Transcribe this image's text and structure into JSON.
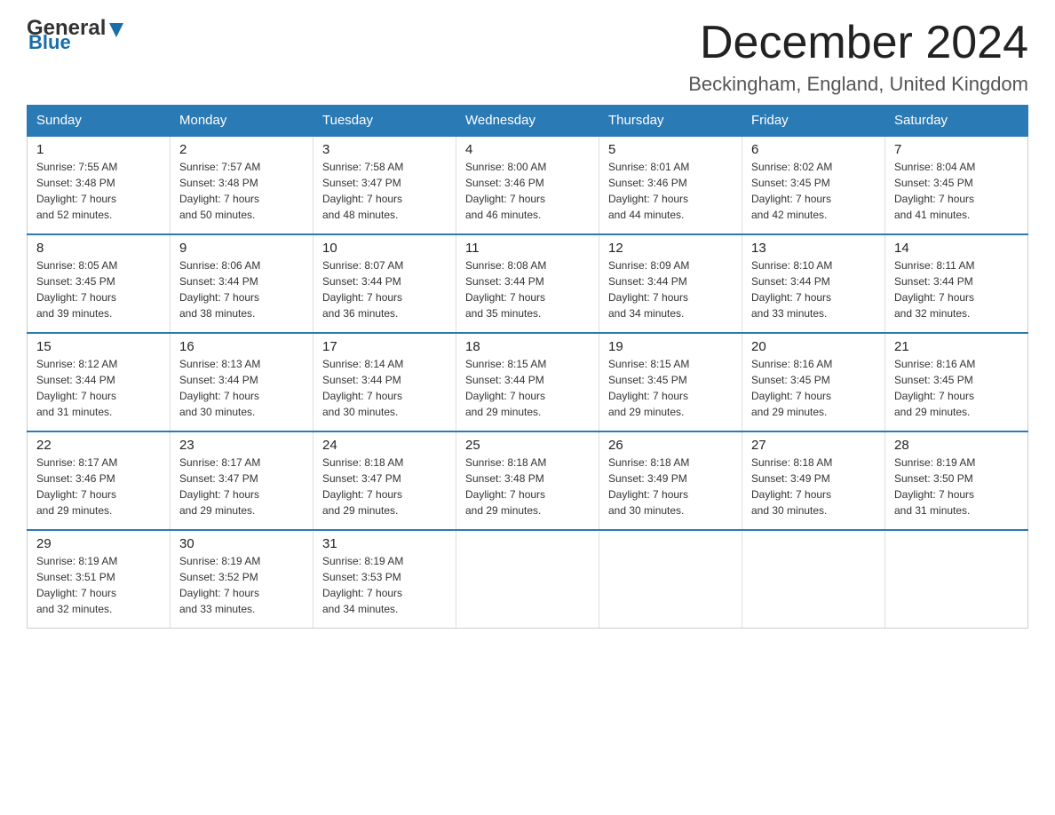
{
  "header": {
    "month_year": "December 2024",
    "location": "Beckingham, England, United Kingdom",
    "logo_text1": "General",
    "logo_text2": "Blue"
  },
  "days_of_week": [
    "Sunday",
    "Monday",
    "Tuesday",
    "Wednesday",
    "Thursday",
    "Friday",
    "Saturday"
  ],
  "weeks": [
    [
      {
        "day": "1",
        "sunrise": "7:55 AM",
        "sunset": "3:48 PM",
        "daylight": "7 hours and 52 minutes."
      },
      {
        "day": "2",
        "sunrise": "7:57 AM",
        "sunset": "3:48 PM",
        "daylight": "7 hours and 50 minutes."
      },
      {
        "day": "3",
        "sunrise": "7:58 AM",
        "sunset": "3:47 PM",
        "daylight": "7 hours and 48 minutes."
      },
      {
        "day": "4",
        "sunrise": "8:00 AM",
        "sunset": "3:46 PM",
        "daylight": "7 hours and 46 minutes."
      },
      {
        "day": "5",
        "sunrise": "8:01 AM",
        "sunset": "3:46 PM",
        "daylight": "7 hours and 44 minutes."
      },
      {
        "day": "6",
        "sunrise": "8:02 AM",
        "sunset": "3:45 PM",
        "daylight": "7 hours and 42 minutes."
      },
      {
        "day": "7",
        "sunrise": "8:04 AM",
        "sunset": "3:45 PM",
        "daylight": "7 hours and 41 minutes."
      }
    ],
    [
      {
        "day": "8",
        "sunrise": "8:05 AM",
        "sunset": "3:45 PM",
        "daylight": "7 hours and 39 minutes."
      },
      {
        "day": "9",
        "sunrise": "8:06 AM",
        "sunset": "3:44 PM",
        "daylight": "7 hours and 38 minutes."
      },
      {
        "day": "10",
        "sunrise": "8:07 AM",
        "sunset": "3:44 PM",
        "daylight": "7 hours and 36 minutes."
      },
      {
        "day": "11",
        "sunrise": "8:08 AM",
        "sunset": "3:44 PM",
        "daylight": "7 hours and 35 minutes."
      },
      {
        "day": "12",
        "sunrise": "8:09 AM",
        "sunset": "3:44 PM",
        "daylight": "7 hours and 34 minutes."
      },
      {
        "day": "13",
        "sunrise": "8:10 AM",
        "sunset": "3:44 PM",
        "daylight": "7 hours and 33 minutes."
      },
      {
        "day": "14",
        "sunrise": "8:11 AM",
        "sunset": "3:44 PM",
        "daylight": "7 hours and 32 minutes."
      }
    ],
    [
      {
        "day": "15",
        "sunrise": "8:12 AM",
        "sunset": "3:44 PM",
        "daylight": "7 hours and 31 minutes."
      },
      {
        "day": "16",
        "sunrise": "8:13 AM",
        "sunset": "3:44 PM",
        "daylight": "7 hours and 30 minutes."
      },
      {
        "day": "17",
        "sunrise": "8:14 AM",
        "sunset": "3:44 PM",
        "daylight": "7 hours and 30 minutes."
      },
      {
        "day": "18",
        "sunrise": "8:15 AM",
        "sunset": "3:44 PM",
        "daylight": "7 hours and 29 minutes."
      },
      {
        "day": "19",
        "sunrise": "8:15 AM",
        "sunset": "3:45 PM",
        "daylight": "7 hours and 29 minutes."
      },
      {
        "day": "20",
        "sunrise": "8:16 AM",
        "sunset": "3:45 PM",
        "daylight": "7 hours and 29 minutes."
      },
      {
        "day": "21",
        "sunrise": "8:16 AM",
        "sunset": "3:45 PM",
        "daylight": "7 hours and 29 minutes."
      }
    ],
    [
      {
        "day": "22",
        "sunrise": "8:17 AM",
        "sunset": "3:46 PM",
        "daylight": "7 hours and 29 minutes."
      },
      {
        "day": "23",
        "sunrise": "8:17 AM",
        "sunset": "3:47 PM",
        "daylight": "7 hours and 29 minutes."
      },
      {
        "day": "24",
        "sunrise": "8:18 AM",
        "sunset": "3:47 PM",
        "daylight": "7 hours and 29 minutes."
      },
      {
        "day": "25",
        "sunrise": "8:18 AM",
        "sunset": "3:48 PM",
        "daylight": "7 hours and 29 minutes."
      },
      {
        "day": "26",
        "sunrise": "8:18 AM",
        "sunset": "3:49 PM",
        "daylight": "7 hours and 30 minutes."
      },
      {
        "day": "27",
        "sunrise": "8:18 AM",
        "sunset": "3:49 PM",
        "daylight": "7 hours and 30 minutes."
      },
      {
        "day": "28",
        "sunrise": "8:19 AM",
        "sunset": "3:50 PM",
        "daylight": "7 hours and 31 minutes."
      }
    ],
    [
      {
        "day": "29",
        "sunrise": "8:19 AM",
        "sunset": "3:51 PM",
        "daylight": "7 hours and 32 minutes."
      },
      {
        "day": "30",
        "sunrise": "8:19 AM",
        "sunset": "3:52 PM",
        "daylight": "7 hours and 33 minutes."
      },
      {
        "day": "31",
        "sunrise": "8:19 AM",
        "sunset": "3:53 PM",
        "daylight": "7 hours and 34 minutes."
      },
      {
        "day": "",
        "sunrise": "",
        "sunset": "",
        "daylight": ""
      },
      {
        "day": "",
        "sunrise": "",
        "sunset": "",
        "daylight": ""
      },
      {
        "day": "",
        "sunrise": "",
        "sunset": "",
        "daylight": ""
      },
      {
        "day": "",
        "sunrise": "",
        "sunset": "",
        "daylight": ""
      }
    ]
  ],
  "labels": {
    "sunrise": "Sunrise:",
    "sunset": "Sunset:",
    "daylight": "Daylight:"
  },
  "colors": {
    "header_bg": "#2a7ab5",
    "header_text": "#ffffff",
    "border": "#2a7ab5"
  }
}
